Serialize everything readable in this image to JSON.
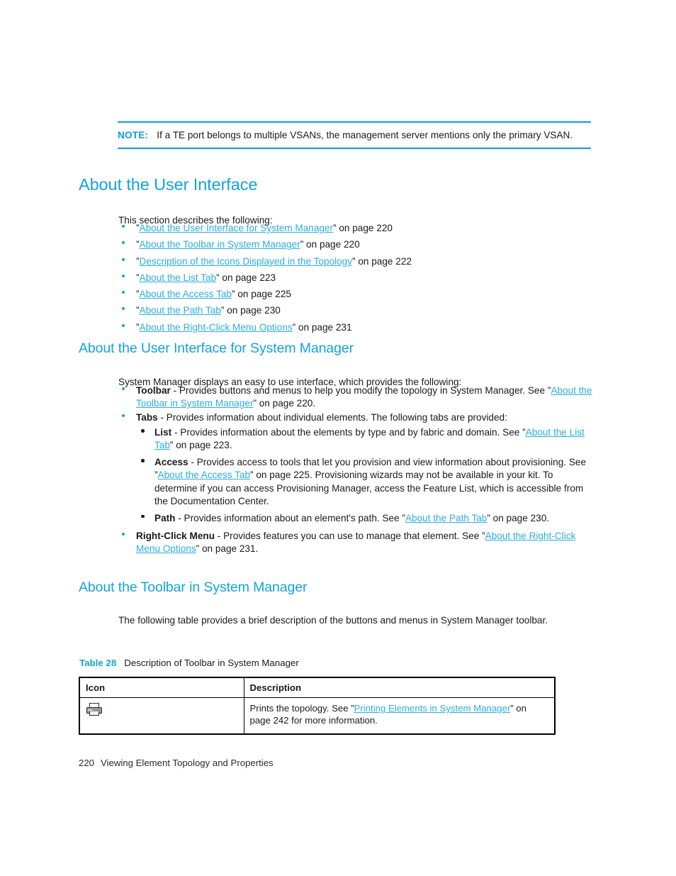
{
  "colors": {
    "heading": "#12A3E0",
    "link": "#2BADE4",
    "rule": "#0C9FDB",
    "body_text": "#1a1a1a",
    "table_border": "#000000"
  },
  "note": {
    "label": "NOTE:",
    "text": "If a TE port belongs to multiple VSANs, the management server mentions only the primary VSAN."
  },
  "sections": {
    "about_user_interface": {
      "heading": "About the User Interface",
      "intro": "This section describes the following:",
      "toc": [
        {
          "quote_open": "”",
          "link": "About the User Interface for System Manager",
          "quote_close": "”",
          "suffix": " on page 220"
        },
        {
          "quote_open": "”",
          "link": "About the Toolbar in System Manager",
          "quote_close": "”",
          "suffix": " on page 220"
        },
        {
          "quote_open": "”",
          "link": "Description of the Icons Displayed in the Topology",
          "quote_close": "”",
          "suffix": " on page 222"
        },
        {
          "quote_open": "”",
          "link": "About the List Tab",
          "quote_close": "”",
          "suffix": " on page 223"
        },
        {
          "quote_open": "”",
          "link": "About the Access Tab",
          "quote_close": "”",
          "suffix": " on page 225"
        },
        {
          "quote_open": "”",
          "link": "About the Path Tab",
          "quote_close": "”",
          "suffix": " on page 230"
        },
        {
          "quote_open": "”",
          "link": "About the Right-Click Menu Options",
          "quote_close": "”",
          "suffix": " on page 231"
        }
      ]
    },
    "about_ui_for_system_manager": {
      "heading": "About the User Interface for System Manager",
      "intro": "System Manager displays an easy to use interface, which provides the following:",
      "toolbar_item": {
        "term": "Toolbar",
        "text_before": " - Provides buttons and menus to help you modify the topology in System Manager. See ”",
        "link": "About the Toolbar in System Manager",
        "text_after": "” on page 220."
      },
      "tabs_item": {
        "term": "Tabs",
        "text": " - Provides information about individual elements. The following tabs are provided:"
      },
      "tabs": [
        {
          "term": "List",
          "text_before": " - Provides information about the elements by type and by fabric and domain. See ”",
          "link": "About the List Tab",
          "text_after": "” on page 223."
        },
        {
          "term": "Access",
          "text_before": " - Provides access to tools that let you provision and view information about provisioning. See ”",
          "link": "About the Access Tab",
          "text_after": "” on page 225. Provisioning wizards may not be available in your kit. To determine if you can access Provisioning Manager, access the Feature List, which is accessible from the Documentation Center."
        },
        {
          "term": "Path",
          "text_before": " - Provides information about an element's path. See ”",
          "link": "About the Path Tab",
          "text_after": "” on page 230."
        }
      ],
      "right_click_item": {
        "term": "Right-Click Menu",
        "text_before": " - Provides features you can use to manage that element. See ”",
        "link": "About the Right-Click Menu Options",
        "text_after": "” on page 231."
      }
    },
    "about_toolbar": {
      "heading": "About the Toolbar in System Manager",
      "intro": "The following table provides a brief description of the buttons and menus in System Manager toolbar."
    }
  },
  "table": {
    "caption_number": "Table 28",
    "caption_text": "Description of Toolbar in System Manager",
    "headers": [
      "Icon",
      "Description"
    ],
    "rows": [
      {
        "icon": "printer-icon",
        "desc_before": "Prints the topology. See ”",
        "desc_link": "Printing Elements in System Manager",
        "desc_after": "” on page 242 for more information."
      }
    ]
  },
  "footer": {
    "page_number": "220",
    "chapter_title": "Viewing Element Topology and Properties"
  }
}
